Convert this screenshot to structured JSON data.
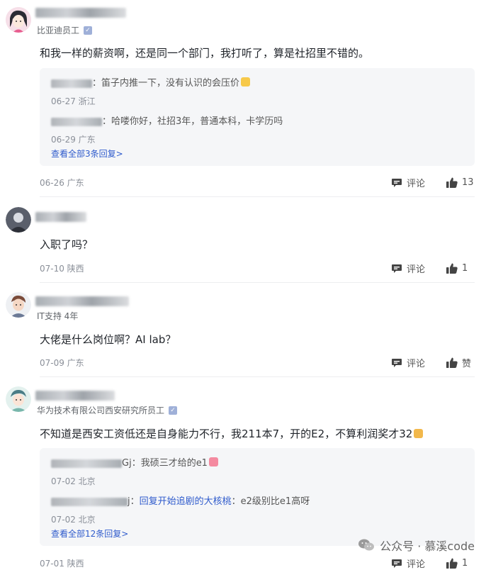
{
  "comments": [
    {
      "author_meta": "比亚迪员工",
      "content": "和我一样的薪资啊，还是同一个部门，我打听了，算是社招里不错的。",
      "replies": [
        {
          "text": "：笛子内推一下，没有认识的会压价",
          "meta": "06-27 浙江"
        },
        {
          "text": "：哈喽你好，社招3年，普通本科，卡学历吗",
          "meta": "06-29 广东"
        }
      ],
      "view_all": "查看全部3条回复>",
      "date": "06-26 广东",
      "comment_label": "评论",
      "likes": "13"
    },
    {
      "author_meta": "",
      "content": "入职了吗？",
      "date": "07-10 陕西",
      "comment_label": "评论",
      "likes": "1"
    },
    {
      "author_meta": "IT支持 4年",
      "content": "大佬是什么岗位啊？AI lab？",
      "date": "07-09 广东",
      "comment_label": "评论",
      "likes": "赞"
    },
    {
      "author_meta": "华为技术有限公司西安研究所员工",
      "content": "不知道是西安工资低还是自身能力不行，我211本7，开的E2，不算利润奖才32",
      "replies": [
        {
          "name_suffix": "Gj",
          "text": "：我硕三才给的e1",
          "meta": "07-02 北京"
        },
        {
          "name_suffix": "j",
          "reply_to": "回复开始追剧的大核桃",
          "text": "：e2级别比e1高呀",
          "meta": "07-02 北京"
        }
      ],
      "view_all": "查看全部12条回复>",
      "date": "07-01 陕西",
      "comment_label": "评论",
      "likes": "1"
    }
  ],
  "watermark": {
    "text": "公众号 · 慕溪code"
  }
}
